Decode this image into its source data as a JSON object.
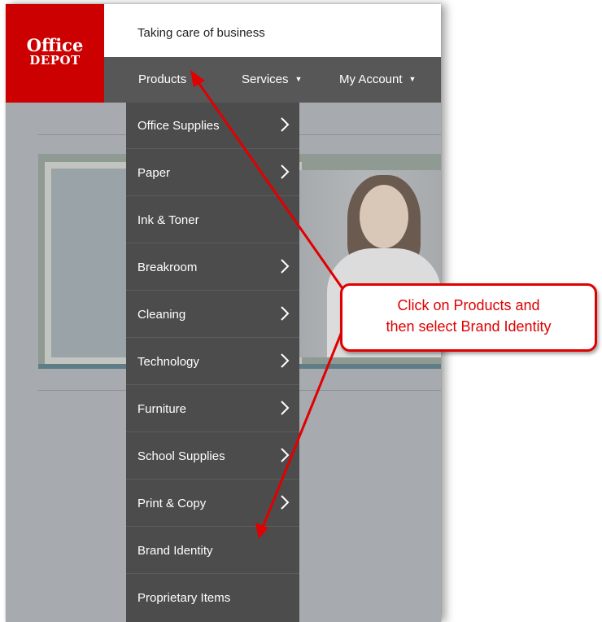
{
  "header": {
    "logo": {
      "line1": "Office",
      "line2": "DEPOT",
      "color": "#cc0000"
    },
    "tagline": "Taking care of business"
  },
  "nav": {
    "items": [
      {
        "label": "Products"
      },
      {
        "label": "Services"
      },
      {
        "label": "My Account"
      }
    ],
    "caret_icon": "caret-down-icon",
    "color": "#575757"
  },
  "products_menu": {
    "items": [
      {
        "label": "Office Supplies",
        "has_submenu": true
      },
      {
        "label": "Paper",
        "has_submenu": true
      },
      {
        "label": "Ink & Toner",
        "has_submenu": false
      },
      {
        "label": "Breakroom",
        "has_submenu": true
      },
      {
        "label": "Cleaning",
        "has_submenu": true
      },
      {
        "label": "Technology",
        "has_submenu": true
      },
      {
        "label": "Furniture",
        "has_submenu": true
      },
      {
        "label": "School Supplies",
        "has_submenu": true
      },
      {
        "label": "Print & Copy",
        "has_submenu": true
      },
      {
        "label": "Brand Identity",
        "has_submenu": false
      },
      {
        "label": "Proprietary Items",
        "has_submenu": false
      }
    ],
    "chevron_icon": "chevron-right-icon",
    "color": "#4c4c4c"
  },
  "callout": {
    "line1": "Click on Products and",
    "line2": "then select Brand Identity",
    "color": "#e00000"
  }
}
